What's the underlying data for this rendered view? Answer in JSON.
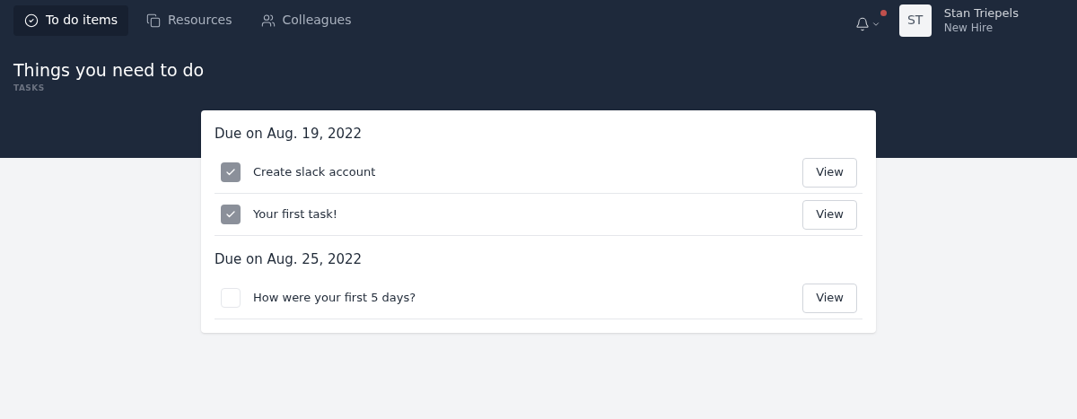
{
  "nav": {
    "tabs": [
      {
        "label": "To do items",
        "selected": true
      },
      {
        "label": "Resources",
        "selected": false
      },
      {
        "label": "Colleagues",
        "selected": false
      }
    ],
    "notifications": {
      "unread": true
    },
    "user": {
      "initials": "ST",
      "name": "Stan Triepels",
      "role": "New Hire"
    }
  },
  "page": {
    "title": "Things you need to do",
    "subtitle": "TASKS"
  },
  "groups": [
    {
      "heading": "Due on Aug. 19, 2022",
      "tasks": [
        {
          "label": "Create slack account",
          "checked": true,
          "action": "View"
        },
        {
          "label": "Your first task!",
          "checked": true,
          "action": "View"
        }
      ]
    },
    {
      "heading": "Due on Aug. 25, 2022",
      "tasks": [
        {
          "label": "How were your first 5 days?",
          "checked": false,
          "action": "View"
        }
      ]
    }
  ]
}
